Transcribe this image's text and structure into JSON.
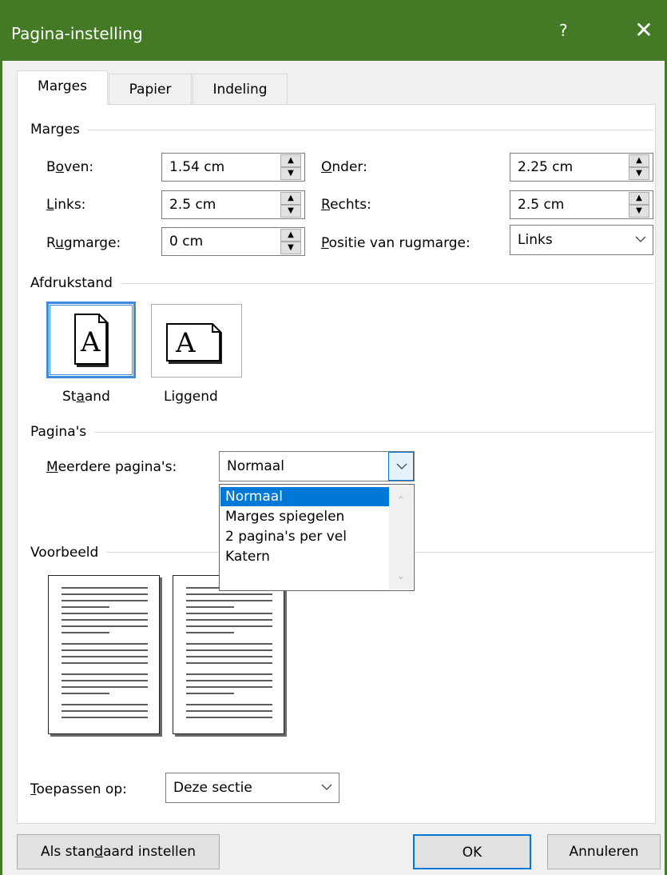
{
  "window": {
    "title": "Pagina-instelling",
    "help": "?",
    "close": "✕"
  },
  "tabs": [
    {
      "label": "Marges"
    },
    {
      "label": "Papier"
    },
    {
      "label": "Indeling"
    }
  ],
  "margins": {
    "group_title": "Marges",
    "top": {
      "pre": "B",
      "ul": "o",
      "post": "ven:",
      "value": "1.54 cm"
    },
    "bottom": {
      "pre": "",
      "ul": "O",
      "post": "nder:",
      "value": "2.25 cm"
    },
    "left": {
      "pre": "",
      "ul": "L",
      "post": "inks:",
      "value": "2.5 cm"
    },
    "right": {
      "pre": "",
      "ul": "R",
      "post": "echts:",
      "value": "2.5 cm"
    },
    "gutter": {
      "pre": "R",
      "ul": "u",
      "post": "gmarge:",
      "value": "0 cm"
    },
    "gutter_pos": {
      "pre": "",
      "ul": "P",
      "post": "ositie van rugmarge:",
      "value": "Links"
    }
  },
  "orientation": {
    "group_title": "Afdrukstand",
    "portrait": {
      "pre": "St",
      "ul": "a",
      "post": "and"
    },
    "landscape": {
      "pre": "Lig",
      "ul": "g",
      "post": "end"
    },
    "icon_letter": "A"
  },
  "pages": {
    "group_title": "Pagina's",
    "multiple": {
      "pre": "",
      "ul": "M",
      "post": "eerdere pagina's:",
      "value": "Normaal"
    },
    "options": [
      "Normaal",
      "Marges spiegelen",
      "2 pagina's per vel",
      "Katern"
    ],
    "selected_option_index": 0
  },
  "preview": {
    "group_title": "Voorbeeld"
  },
  "apply": {
    "pre": "",
    "ul": "T",
    "post": "oepassen op:",
    "value": "Deze sectie"
  },
  "buttons": {
    "default": {
      "pre": "Als stan",
      "ul": "d",
      "post": "aard instellen"
    },
    "ok": "OK",
    "cancel": "Annuleren"
  },
  "colors": {
    "titlebar": "#447a26",
    "accent": "#0078d7",
    "selection_border": "#3d8be0"
  },
  "icons": {
    "spin_up": "triangle-up-icon",
    "spin_down": "triangle-down-icon",
    "dropdown": "chevron-down-icon"
  }
}
